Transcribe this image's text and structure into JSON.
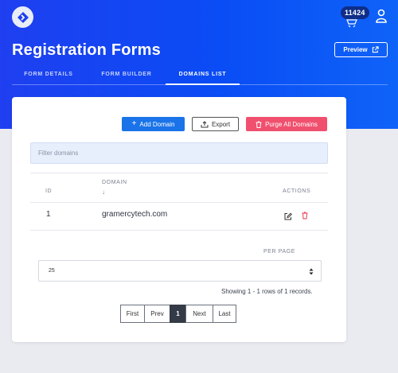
{
  "header": {
    "badge": "11424",
    "title": "Registration Forms",
    "preview_label": "Preview"
  },
  "tabs": [
    {
      "label": "FORM DETAILS"
    },
    {
      "label": "FORM BUILDER"
    },
    {
      "label": "DOMAINS LIST",
      "active": true
    }
  ],
  "toolbar": {
    "add_label": "Add Domain",
    "export_label": "Export",
    "purge_label": "Purge All Domains"
  },
  "filter": {
    "placeholder": "Filter domains",
    "value": ""
  },
  "table": {
    "headers": {
      "id": "ID",
      "domain": "DOMAIN",
      "sort": "↓",
      "actions": "ACTIONS"
    },
    "rows": [
      {
        "id": "1",
        "domain": "gramercytech.com"
      }
    ]
  },
  "pagination": {
    "per_page_label": "PER PAGE",
    "per_page_value": "25",
    "showing": "Showing 1 - 1 rows of 1 records.",
    "buttons": {
      "first": "First",
      "prev": "Prev",
      "current": "1",
      "next": "Next",
      "last": "Last"
    }
  },
  "colors": {
    "hero": "#1f3ff0",
    "primary": "#1a73e8",
    "danger": "#f0506e",
    "filter_bg": "#e8effc"
  },
  "icons": [
    "app-logo-icon",
    "bell-icon",
    "user-icon",
    "external-link-icon",
    "plus-icon",
    "export-icon",
    "trash-icon",
    "edit-icon",
    "sort-arrows-icon"
  ]
}
